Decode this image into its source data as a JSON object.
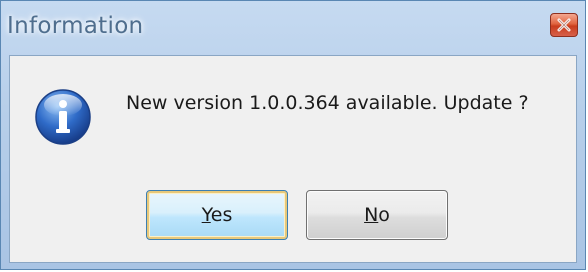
{
  "window": {
    "title": "Information"
  },
  "message": {
    "text": "New version 1.0.0.364 available. Update ?"
  },
  "buttons": {
    "yes_label": "Yes",
    "yes_accel": "Y",
    "yes_rest": "es",
    "no_label": "No",
    "no_accel": "N",
    "no_rest": "o"
  },
  "icons": {
    "info": "information-icon",
    "close": "close-icon"
  },
  "colors": {
    "close_button": "#d6553a",
    "info_icon": "#2f6bc8",
    "default_button_border": "#3c7fb1"
  }
}
